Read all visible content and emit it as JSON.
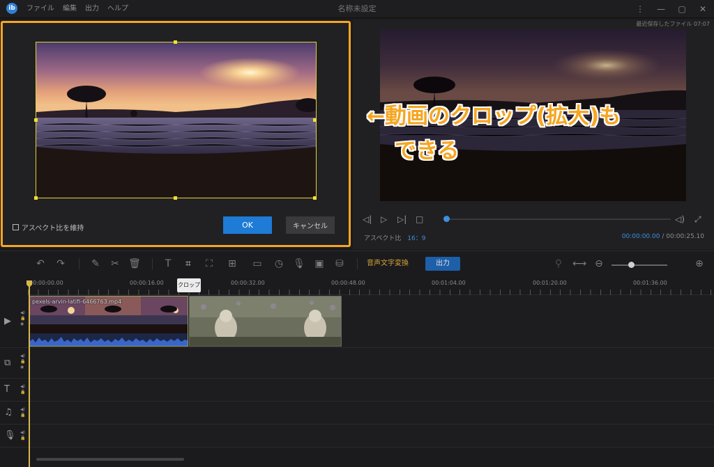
{
  "app": {
    "logo": "ib",
    "menu": [
      "ファイル",
      "編集",
      "出力",
      "ヘルプ"
    ],
    "title": "名称未設定",
    "window_controls": [
      "kebab-icon",
      "minimize-icon",
      "maximize-icon",
      "close-icon"
    ]
  },
  "crop_dialog": {
    "keep_aspect_label": "アスペクト比を維持",
    "keep_aspect_checked": false,
    "ok_label": "OK",
    "cancel_label": "キャンセル"
  },
  "preview": {
    "recent_save": "最近保存したファイル 07:07",
    "overlay_line1": "←動画のクロップ(拡大)も",
    "overlay_line2": "できる",
    "aspect_label": "アスペクト比",
    "aspect_value": "16：9",
    "current_time": "00:00:00.00",
    "time_separator": "/",
    "total_time": "00:00:25.10",
    "progress": 0.0
  },
  "toolbar": {
    "speech_to_text_label": "音声文字変換",
    "export_label": "出力",
    "tooltip": "クロップ",
    "zoom_level": 0.35,
    "colors": {
      "accent": "#f5a623",
      "blue": "#1e7bd6",
      "stt": "#d4a43a"
    }
  },
  "timeline": {
    "ruler": [
      "00:00:00.00",
      "00:00:16.00",
      "00:00:32.00",
      "00:00:48.00",
      "00:01:04.00",
      "00:01:20.00",
      "00:01:36.00"
    ],
    "clip1_name": "pexels-arvin-latifi-6466763.mp4",
    "tracks": [
      "video-track",
      "overlay-track",
      "text-track",
      "music-track",
      "voice-track"
    ]
  }
}
